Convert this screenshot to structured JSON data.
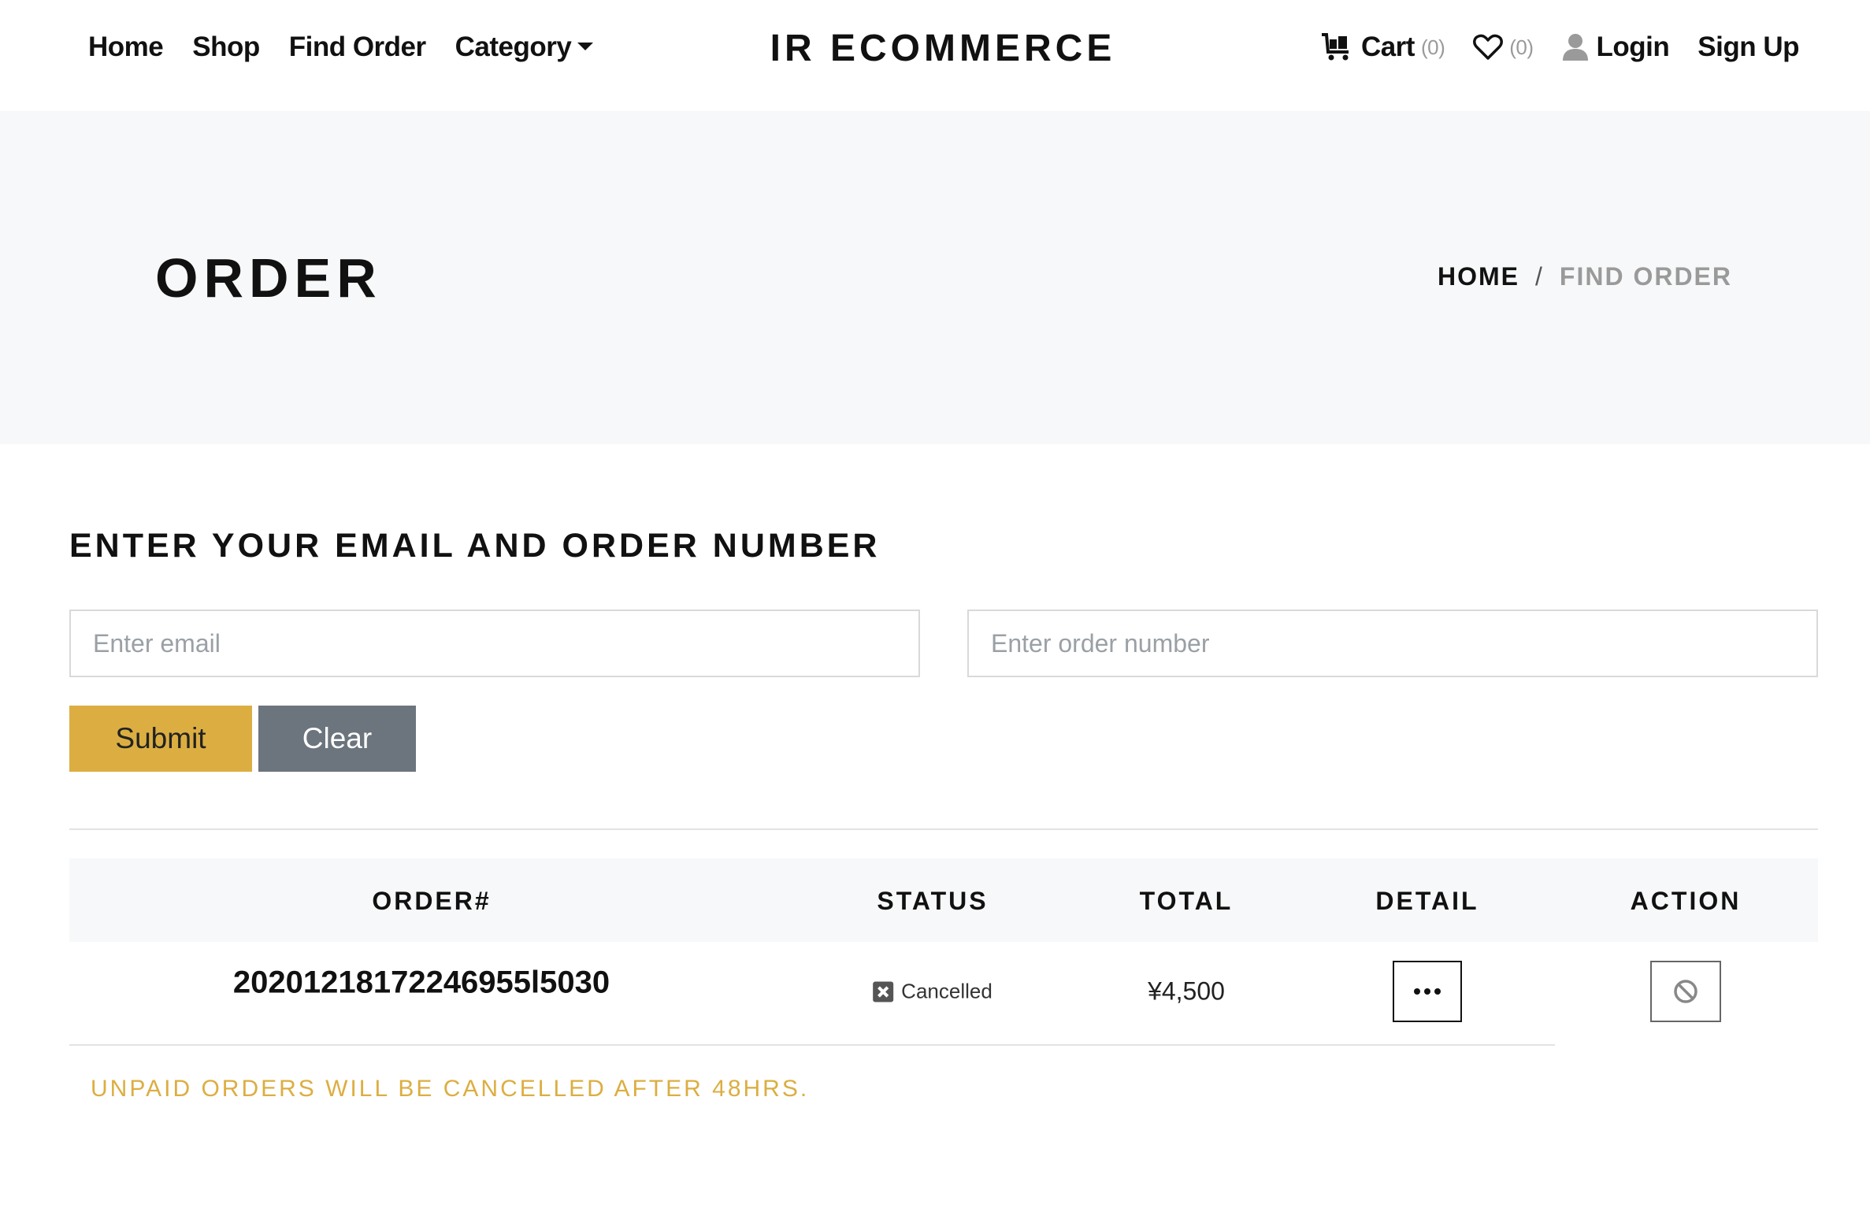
{
  "nav": {
    "home": "Home",
    "shop": "Shop",
    "find_order": "Find Order",
    "category": "Category",
    "brand": "IR ECOMMERCE",
    "cart": "Cart",
    "cart_count": "(0)",
    "wishlist_count": "(0)",
    "login": "Login",
    "signup": "Sign Up"
  },
  "banner": {
    "title": "ORDER",
    "breadcrumb": {
      "home": "HOME",
      "separator": "/",
      "current": "FIND ORDER"
    }
  },
  "form": {
    "heading": "ENTER YOUR EMAIL AND ORDER NUMBER",
    "email_placeholder": "Enter email",
    "email_value": "",
    "order_placeholder": "Enter order number",
    "order_value": "",
    "submit_label": "Submit",
    "clear_label": "Clear"
  },
  "table": {
    "headers": [
      "ORDER#",
      "STATUS",
      "TOTAL",
      "DETAIL",
      "ACTION"
    ],
    "rows": [
      {
        "order_number": "20201218172246955l5030",
        "status": "Cancelled",
        "total": "¥4,500",
        "detail_icon": "ellipsis-icon",
        "action_icon": "ban-icon"
      }
    ]
  },
  "notice": "UNPAID ORDERS WILL BE CANCELLED AFTER 48HRS.",
  "colors": {
    "accent": "#dcae42",
    "secondary": "#6c757d",
    "banner_bg": "#f7f8f9",
    "muted": "#9a9a9a"
  }
}
